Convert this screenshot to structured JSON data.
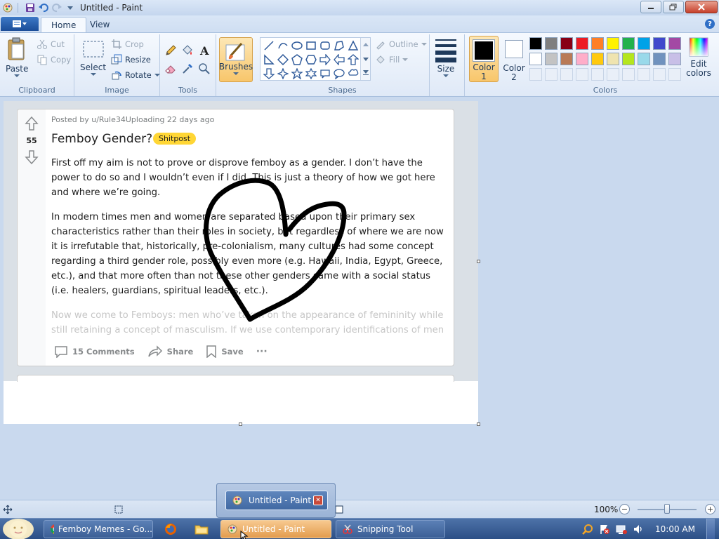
{
  "window": {
    "title": "Untitled - Paint"
  },
  "tabs": {
    "home": "Home",
    "view": "View"
  },
  "ribbon": {
    "clipboard": {
      "label": "Clipboard",
      "paste": "Paste",
      "cut": "Cut",
      "copy": "Copy"
    },
    "image": {
      "label": "Image",
      "select": "Select",
      "crop": "Crop",
      "resize": "Resize",
      "rotate": "Rotate"
    },
    "tools": {
      "label": "Tools"
    },
    "brushes": {
      "label": "Brushes"
    },
    "shapes": {
      "label": "Shapes",
      "outline": "Outline",
      "fill": "Fill"
    },
    "size": {
      "label": "Size"
    },
    "color1": {
      "label1": "Color",
      "label2": "1"
    },
    "color2": {
      "label1": "Color",
      "label2": "2"
    },
    "colors": {
      "label": "Colors",
      "edit1": "Edit",
      "edit2": "colors"
    },
    "palette_row1": [
      "#000000",
      "#7f7f7f",
      "#880015",
      "#ed1c24",
      "#ff7f27",
      "#fff200",
      "#22b14c",
      "#00a2e8",
      "#3f48cc",
      "#a349a4"
    ],
    "palette_row2": [
      "#ffffff",
      "#c3c3c3",
      "#b97a57",
      "#ffaec9",
      "#ffc90e",
      "#efe4b0",
      "#b5e61d",
      "#99d9ea",
      "#7092be",
      "#c8bfe7"
    ]
  },
  "post": {
    "votes": "55",
    "meta": "Posted by u/Rule34Uploading 22 days ago",
    "title": "Femboy Gender?",
    "flair": "Shitpost",
    "p1": "First off my aim is not to prove or disprove femboy as a gender. I don’t have the power to do so and I wouldn’t even if I did. This is just a theory of how we got here and where we’re going.",
    "p2": "In modern times men and women are separated based upon their primary sex characteristics rather than their roles in society, but regardless of where we are now it is irrefutable that, historically, pre-colonialism, many cultures had some concept regarding a third gender role, possibly even more (e.g. Hawaii, India, Egypt, Greece, etc.), and that more often than not these other genders came with a social status (i.e. healers, guardians, spiritual leaders, etc.).",
    "p3": "Now we come to Femboys: men who’ve taken on the appearance of femininity while still retaining a concept of masculism. If we use contemporary identifications of men",
    "comments": "15 Comments",
    "share": "Share",
    "save": "Save",
    "more": "···"
  },
  "statusbar": {
    "zoom": "100%"
  },
  "popup": {
    "title": "Untitled - Paint"
  },
  "taskbar": {
    "chrome": "Femboy Memes - Go...",
    "paint": "Untitled - Paint",
    "snipping": "Snipping Tool",
    "clock": "10:00 AM"
  }
}
